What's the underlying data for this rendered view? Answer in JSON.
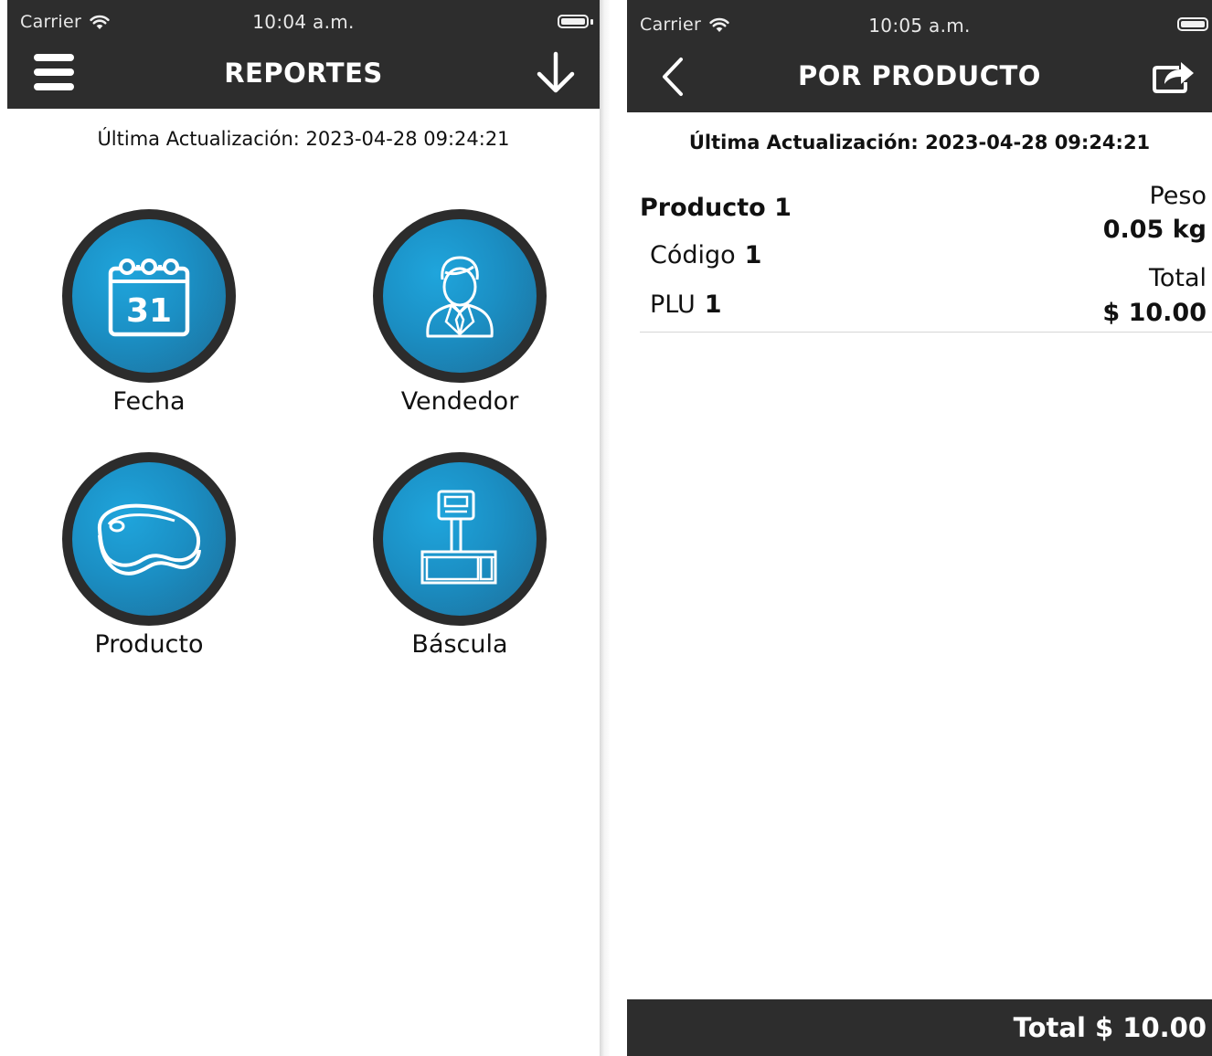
{
  "left": {
    "status": {
      "carrier": "Carrier",
      "time": "10:04 a.m."
    },
    "nav": {
      "title": "REPORTES",
      "menu_icon": "hamburger-menu-icon",
      "action_icon": "download-arrow-icon"
    },
    "last_update": "Última Actualización:  2023-04-28 09:24:21",
    "tiles": [
      {
        "label": "Fecha",
        "icon": "calendar-icon",
        "calendar_day": "31"
      },
      {
        "label": "Vendedor",
        "icon": "salesperson-icon"
      },
      {
        "label": "Producto",
        "icon": "steak-icon"
      },
      {
        "label": "Báscula",
        "icon": "scale-icon"
      }
    ]
  },
  "right": {
    "status": {
      "carrier": "Carrier",
      "time": "10:05 a.m."
    },
    "nav": {
      "title": "POR PRODUCTO",
      "back_icon": "back-chevron-icon",
      "action_icon": "share-export-icon"
    },
    "last_update": "Última Actualización:  2023-04-28 09:24:21",
    "items": [
      {
        "name": "Producto 1",
        "code_label": "Código",
        "code": "1",
        "plu_label": "PLU",
        "plu": "1",
        "weight_label": "Peso",
        "weight": "0.05 kg",
        "total_label": "Total",
        "total": "$ 10.00"
      }
    ],
    "footer_total": "Total $ 10.00"
  },
  "colors": {
    "bar": "#2d2d2d",
    "accent": "#1b8fc4",
    "ring": "#2c2c2c"
  }
}
